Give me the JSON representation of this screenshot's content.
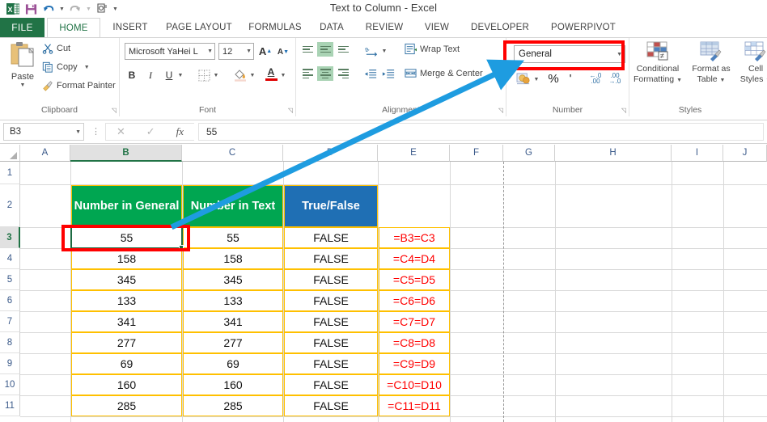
{
  "window": {
    "title": "Text to Column - Excel"
  },
  "quick_access": [
    {
      "name": "excel-logo-icon",
      "label": "Excel"
    },
    {
      "name": "save-icon",
      "label": "Save"
    },
    {
      "name": "undo-icon",
      "label": "Undo"
    },
    {
      "name": "redo-icon",
      "label": "Redo"
    },
    {
      "name": "touch-mode-icon",
      "label": "Touch/Mouse Mode"
    },
    {
      "name": "customize-qat-icon",
      "label": "Customize Quick Access Toolbar"
    }
  ],
  "tabs": [
    {
      "label": "FILE",
      "active": false
    },
    {
      "label": "HOME",
      "active": true
    },
    {
      "label": "INSERT",
      "active": false
    },
    {
      "label": "PAGE LAYOUT",
      "active": false
    },
    {
      "label": "FORMULAS",
      "active": false
    },
    {
      "label": "DATA",
      "active": false
    },
    {
      "label": "REVIEW",
      "active": false
    },
    {
      "label": "VIEW",
      "active": false
    },
    {
      "label": "DEVELOPER",
      "active": false
    },
    {
      "label": "POWERPIVOT",
      "active": false
    }
  ],
  "ribbon": {
    "clipboard": {
      "group_label": "Clipboard",
      "paste_label": "Paste",
      "cut_label": "Cut",
      "copy_label": "Copy",
      "format_painter_label": "Format Painter"
    },
    "font": {
      "group_label": "Font",
      "font_name": "Microsoft YaHei L",
      "font_size": "12",
      "grow_font_label": "A",
      "shrink_font_label": "A",
      "bold_label": "B",
      "italic_label": "I",
      "underline_label": "U"
    },
    "alignment": {
      "group_label": "Alignment",
      "wrap_text_label": "Wrap Text",
      "merge_center_label": "Merge & Center"
    },
    "number": {
      "group_label": "Number",
      "format_value": "General",
      "percent_label": "%",
      "comma_label": "'",
      "increase_decimal_label": ".00",
      "decrease_decimal_label": ".00"
    },
    "styles": {
      "group_label": "Styles",
      "conditional_formatting_label": "Conditional\nFormatting",
      "format_as_table_label": "Format as\nTable",
      "cell_styles_label": "Cell\nStyles"
    }
  },
  "formula_bar": {
    "name_box_value": "B3",
    "cancel_label": "✕",
    "enter_label": "✓",
    "fx_label": "fx",
    "formula_value": "55"
  },
  "grid": {
    "column_headers": [
      "A",
      "B",
      "C",
      "D",
      "E",
      "F",
      "G",
      "H",
      "I",
      "J"
    ],
    "selected_column": "B",
    "row_headers": [
      "1",
      "2",
      "3",
      "4",
      "5",
      "6",
      "7",
      "8",
      "9",
      "10",
      "11"
    ],
    "selected_row": "3",
    "table_headers": {
      "b": "Number in General",
      "c": "Number in Text",
      "d": "True/False"
    },
    "rows": [
      {
        "row": "3",
        "b": "55",
        "c": "55",
        "d": "FALSE",
        "e": "=B3=C3"
      },
      {
        "row": "4",
        "b": "158",
        "c": "158",
        "d": "FALSE",
        "e": "=C4=D4"
      },
      {
        "row": "5",
        "b": "345",
        "c": "345",
        "d": "FALSE",
        "e": "=C5=D5"
      },
      {
        "row": "6",
        "b": "133",
        "c": "133",
        "d": "FALSE",
        "e": "=C6=D6"
      },
      {
        "row": "7",
        "b": "341",
        "c": "341",
        "d": "FALSE",
        "e": "=C7=D7"
      },
      {
        "row": "8",
        "b": "277",
        "c": "277",
        "d": "FALSE",
        "e": "=C8=D8"
      },
      {
        "row": "9",
        "b": "69",
        "c": "69",
        "d": "FALSE",
        "e": "=C9=D9"
      },
      {
        "row": "10",
        "b": "160",
        "c": "160",
        "d": "FALSE",
        "e": "=C10=D10"
      },
      {
        "row": "11",
        "b": "285",
        "c": "285",
        "d": "FALSE",
        "e": "=C11=D11"
      }
    ]
  },
  "annotations": {
    "highlight_color": "#ff0000",
    "arrow_color": "#1e9ce0",
    "targets": [
      "number-format-dropdown",
      "cell-b3"
    ]
  },
  "colors": {
    "excel_green": "#217346",
    "header_green": "#00a651",
    "header_blue": "#1f6fb4",
    "table_border": "#ffc000",
    "formula_red": "#ff0000"
  }
}
